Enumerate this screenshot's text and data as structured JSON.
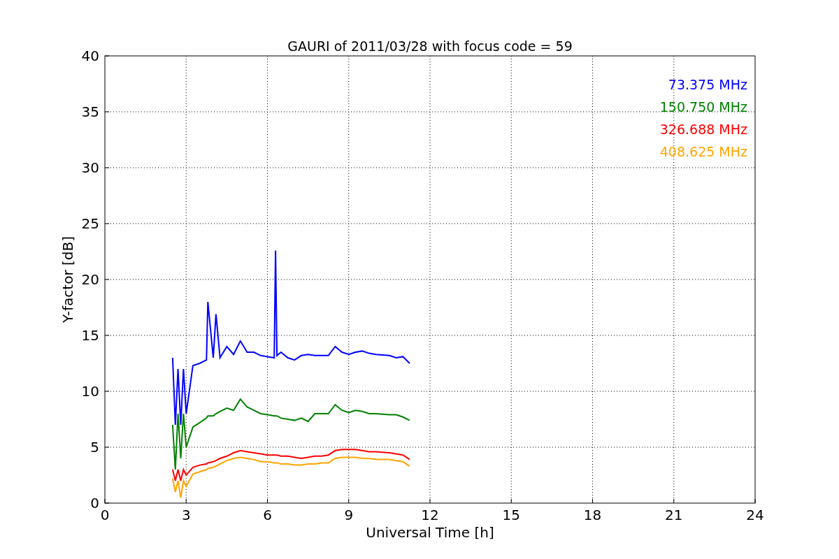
{
  "figure": {
    "chart_data": {
      "type": "line",
      "title": "GAURI of 2011/03/28 with focus code = 59",
      "xlabel": "Universal Time [h]",
      "ylabel": "Y-factor [dB]",
      "x": [
        2.5,
        2.6,
        2.7,
        2.8,
        2.9,
        3.0,
        3.25,
        3.5,
        3.75,
        3.8,
        4.0,
        4.1,
        4.25,
        4.5,
        4.75,
        5.0,
        5.25,
        5.5,
        5.75,
        6.0,
        6.25,
        6.3,
        6.35,
        6.5,
        6.75,
        7.0,
        7.25,
        7.5,
        7.75,
        8.0,
        8.25,
        8.5,
        8.75,
        9.0,
        9.25,
        9.5,
        9.75,
        10.0,
        10.5,
        10.75,
        11.0,
        11.25
      ],
      "series": [
        {
          "name": "73.375 MHz",
          "color": "#0000ff",
          "values": [
            13,
            7,
            12,
            7,
            12,
            8,
            12.3,
            12.5,
            12.8,
            18,
            13,
            16.9,
            13,
            14,
            13.3,
            14.5,
            13.5,
            13.5,
            13.2,
            13.1,
            13,
            22.6,
            13.2,
            13.5,
            13,
            12.8,
            13.2,
            13.3,
            13.2,
            13.2,
            13.2,
            14,
            13.5,
            13.3,
            13.5,
            13.6,
            13.4,
            13.3,
            13.2,
            13,
            13.1,
            12.5
          ]
        },
        {
          "name": "150.750 MHz",
          "color": "#008000",
          "values": [
            7,
            3,
            8,
            4,
            8,
            5,
            6.8,
            7.2,
            7.6,
            7.8,
            7.8,
            8.0,
            8.2,
            8.5,
            8.3,
            9.3,
            8.6,
            8.3,
            8.0,
            7.9,
            7.8,
            7.8,
            7.8,
            7.6,
            7.5,
            7.4,
            7.6,
            7.3,
            8.0,
            8.0,
            8.0,
            8.8,
            8.3,
            8.1,
            8.3,
            8.2,
            8.0,
            8.0,
            7.9,
            7.9,
            7.7,
            7.4
          ]
        },
        {
          "name": "326.688 MHz",
          "color": "#ff0000",
          "values": [
            3,
            2,
            3,
            2,
            3,
            2.5,
            3.2,
            3.4,
            3.5,
            3.6,
            3.7,
            3.8,
            4.0,
            4.2,
            4.5,
            4.7,
            4.6,
            4.5,
            4.4,
            4.3,
            4.3,
            4.3,
            4.3,
            4.2,
            4.2,
            4.1,
            4.0,
            4.1,
            4.2,
            4.2,
            4.3,
            4.7,
            4.8,
            4.8,
            4.8,
            4.7,
            4.6,
            4.6,
            4.5,
            4.4,
            4.3,
            3.9
          ]
        },
        {
          "name": "408.625 MHz",
          "color": "#ffa500",
          "values": [
            2.2,
            1,
            2,
            0.5,
            2,
            1.5,
            2.6,
            2.8,
            3.0,
            3.1,
            3.2,
            3.3,
            3.5,
            3.8,
            4.0,
            4.1,
            4.0,
            3.9,
            3.7,
            3.7,
            3.6,
            3.6,
            3.6,
            3.5,
            3.5,
            3.4,
            3.4,
            3.5,
            3.5,
            3.6,
            3.6,
            4.0,
            4.1,
            4.1,
            4.1,
            4.0,
            4.0,
            3.9,
            3.9,
            3.8,
            3.7,
            3.3
          ]
        }
      ],
      "grid": true,
      "xlim": [
        0,
        24
      ],
      "ylim": [
        0,
        40
      ],
      "xticks": [
        0,
        3,
        6,
        9,
        12,
        15,
        18,
        21,
        24
      ],
      "yticks": [
        0,
        5,
        10,
        15,
        20,
        25,
        30,
        35,
        40
      ]
    }
  }
}
